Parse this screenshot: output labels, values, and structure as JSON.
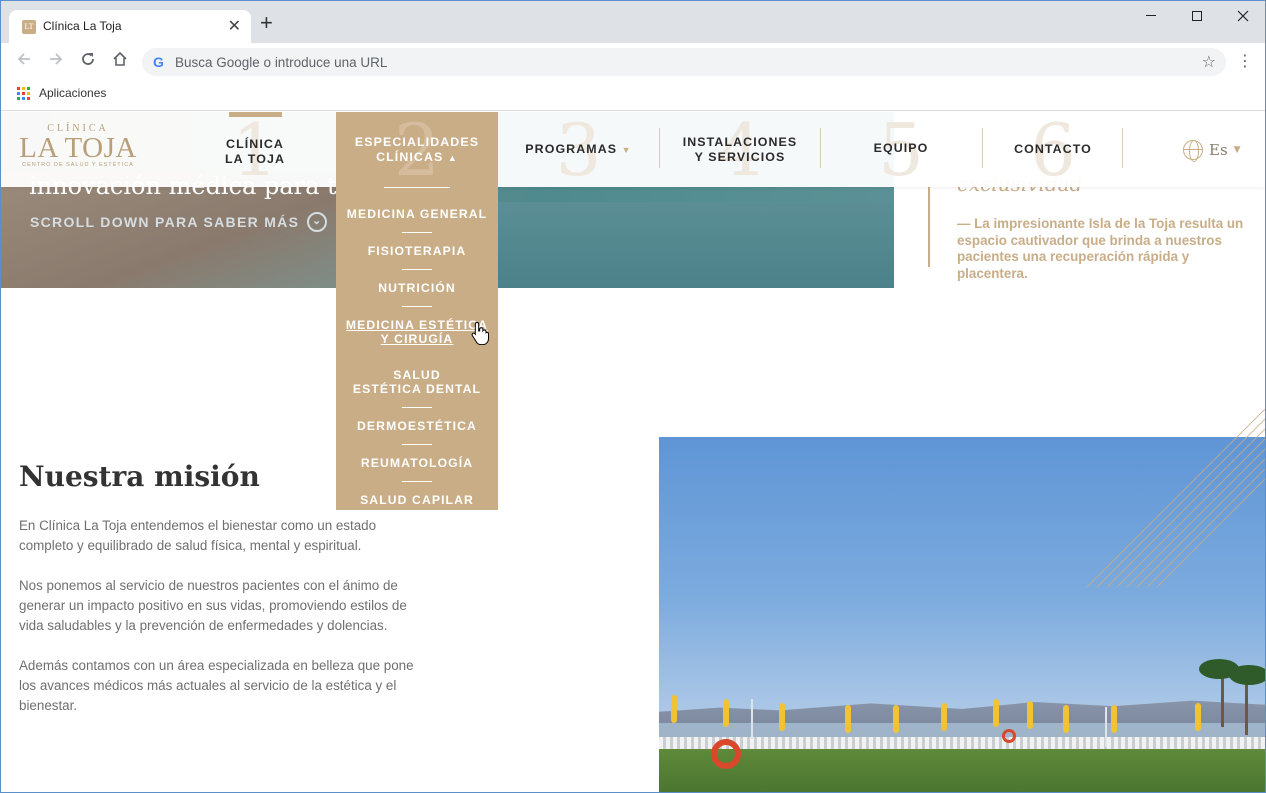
{
  "browser": {
    "tab_title": "Clínica La Toja",
    "tab_close": "✕",
    "new_tab": "+",
    "omnibox_placeholder": "Busca Google o introduce una URL",
    "omnibox_g": "G",
    "bookmark_apps": "Aplicaciones"
  },
  "header": {
    "logo_top": "CLÍNICA",
    "logo_main": "LA TOJA",
    "logo_sub": "CENTRO DE SALUD Y ESTÉTICA",
    "nav": [
      {
        "num": "1",
        "line1": "CLÍNICA",
        "line2": "LA TOJA"
      },
      {
        "num": "2",
        "line1": "ESPECIALIDADES",
        "line2": "CLÍNICAS"
      },
      {
        "num": "3",
        "line1": "PROGRAMAS",
        "line2": ""
      },
      {
        "num": "4",
        "line1": "INSTALACIONES",
        "line2": "Y SERVICIOS"
      },
      {
        "num": "5",
        "line1": "EQUIPO",
        "line2": ""
      },
      {
        "num": "6",
        "line1": "CONTACTO",
        "line2": ""
      }
    ],
    "lang": "Es"
  },
  "dropdown": {
    "items": [
      {
        "line1": "MEDICINA GENERAL",
        "line2": ""
      },
      {
        "line1": "FISIOTERAPIA",
        "line2": ""
      },
      {
        "line1": "NUTRICIÓN",
        "line2": ""
      },
      {
        "line1": "MEDICINA ESTÉTICA",
        "line2": "Y CIRUGÍA"
      },
      {
        "line1": "SALUD",
        "line2": "ESTÉTICA DENTAL"
      },
      {
        "line1": "DERMOESTÉTICA",
        "line2": ""
      },
      {
        "line1": "REUMATOLOGÍA",
        "line2": ""
      },
      {
        "line1": "SALUD CAPILAR",
        "line2": ""
      }
    ],
    "hovered_index": 3
  },
  "hero": {
    "heading": "innovación médica para tu bienestar",
    "scroll_cta": "SCROLL DOWN PARA SABER MÁS"
  },
  "quote": {
    "title_fragment": "exclusividad",
    "text": "— La impresionante Isla de la Toja resulta un espacio cautivador que brinda a nuestros pacientes una recuperación rápida y placentera."
  },
  "mission": {
    "title": "Nuestra misión",
    "p1": "En Clínica La Toja entendemos el bienestar como un estado completo y equilibrado de salud física, mental y espiritual.",
    "p2": "Nos ponemos al servicio de nuestros pacientes con el ánimo de generar un impacto positivo en sus vidas, promoviendo estilos de vida saludables y la prevención de enfermedades y dolencias.",
    "p3": "Además contamos con un área especializada en belleza que pone los avances médicos más actuales al servicio de la estética y el bienestar."
  },
  "colors": {
    "accent": "#c9ad86",
    "text": "#6f6f6f",
    "heading": "#333333"
  }
}
